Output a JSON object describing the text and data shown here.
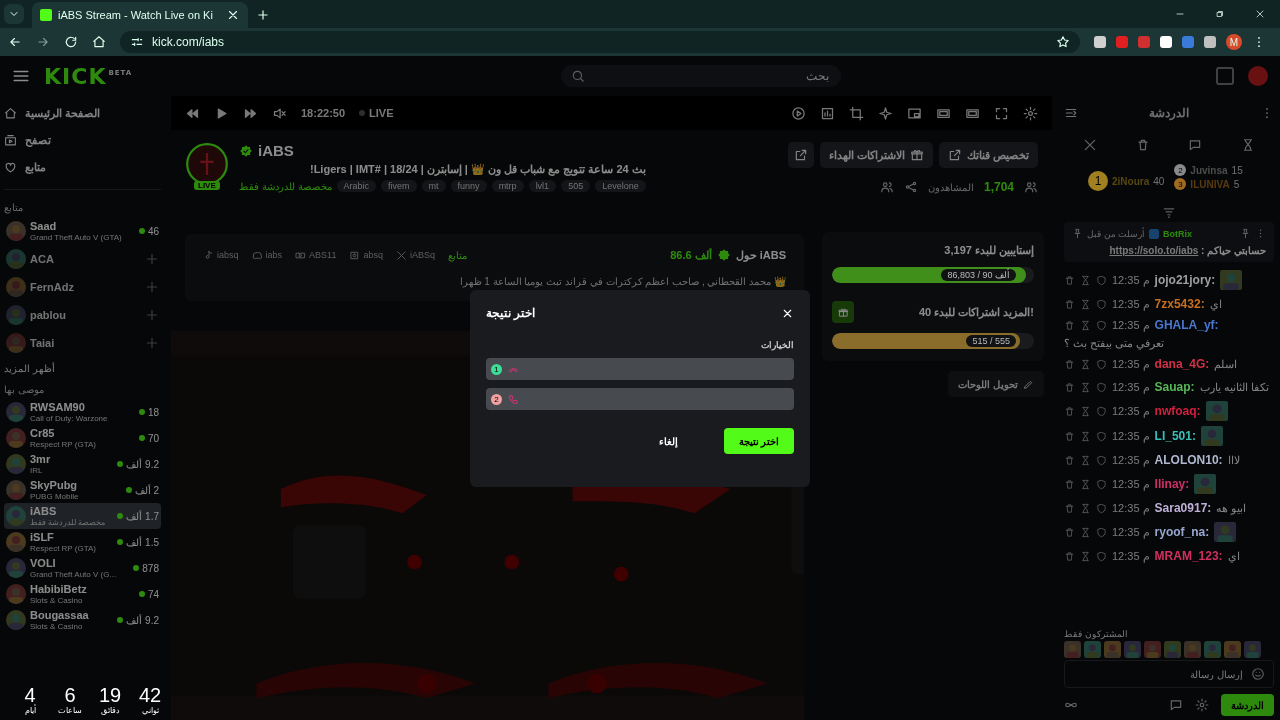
{
  "browser": {
    "tab_title": "iABS Stream - Watch Live on Ki",
    "url": "kick.com/iabs",
    "profile": "M"
  },
  "header": {
    "logo": "KICK",
    "logo_badge": "BETA",
    "search_placeholder": "بحث"
  },
  "sidebar": {
    "nav": [
      {
        "label": "الصفحة الرئيسية",
        "kind": "home"
      },
      {
        "label": "تصفح",
        "kind": "browse"
      },
      {
        "label": "متابع",
        "kind": "heart"
      }
    ],
    "followed_title": "متابع",
    "followed": [
      {
        "name": "Saad",
        "category": "Grand Theft Auto V (GTA)",
        "viewers": "46",
        "live": true
      },
      {
        "name": "ACA",
        "live": false
      },
      {
        "name": "FernAdz",
        "live": false
      },
      {
        "name": "pablou",
        "live": false
      },
      {
        "name": "Taiai",
        "live": false
      }
    ],
    "show_more": "أظهر المزيد",
    "recommended_title": "موصى بها",
    "recommended": [
      {
        "name": "RWSAM90",
        "category": "Call of Duty: Warzone",
        "viewers": "18",
        "selected": false
      },
      {
        "name": "Cr85",
        "category": "Respect RP (GTA)",
        "viewers": "70",
        "selected": false
      },
      {
        "name": "3mr",
        "category": "IRL",
        "viewers": "9.2 ألف",
        "selected": false
      },
      {
        "name": "SkyPubg",
        "category": "PUBG Mobile",
        "viewers": "2 ألف",
        "selected": false
      },
      {
        "name": "iABS",
        "category": "مخصصة للدردشة فقط",
        "viewers": "1.7 ألف",
        "selected": true
      },
      {
        "name": "iSLF",
        "category": "Respect RP (GTA)",
        "viewers": "1.5 ألف",
        "selected": false
      },
      {
        "name": "VOLI",
        "category": "Grand Theft Auto V (G...",
        "viewers": "878",
        "selected": false
      },
      {
        "name": "HabibiBetz",
        "category": "Slots & Casino",
        "viewers": "74",
        "selected": false
      },
      {
        "name": "Bougassaa",
        "category": "Slots & Casino",
        "viewers": "9.2 ألف",
        "selected": false
      }
    ]
  },
  "player": {
    "time": "18:22:50",
    "live": "LIVE"
  },
  "stream": {
    "name": "iABS",
    "live_badge": "LIVE",
    "title": "بث 24 ساعة تتويج مع شباب قل ون 👑 | إسابترن | 18/24 | #Ligers | IMT!",
    "category": "مخصصة للدردشة فقط",
    "tags": [
      "Levelone",
      "505",
      "lvl1",
      "mtrp",
      "funny",
      "mt",
      "fivem",
      "Arabic"
    ],
    "actions": [
      "تخصيص قناتك",
      "الاشتراكات الهداء"
    ],
    "viewers": "1,704",
    "viewers_label": "المشاهدون"
  },
  "about": {
    "title": "حول iABS",
    "followers": "86.6 ألف",
    "followers_label": "متابع",
    "socials": [
      {
        "label": "iABSq",
        "kind": "x"
      },
      {
        "label": "absq",
        "kind": "instagram"
      },
      {
        "label": "ABS11",
        "kind": "youtube"
      },
      {
        "label": "iabs",
        "kind": "discord"
      },
      {
        "label": "iabsq",
        "kind": "tiktok"
      }
    ],
    "bio": "👑 محمد القحطاني , صاحب اعظم كركترات في قراند تبث يوميا الساعة 1 ظهرا"
  },
  "goals": [
    {
      "label": "إستايبين للبدء",
      "count": "3,197",
      "progress": "86,803 / 90 ألف",
      "level": 0.96,
      "color": "#3f8f1a",
      "kind": "follows"
    },
    {
      "label": "!المزيد اشتراكات للبدء",
      "count": "40",
      "progress": "515 / 555",
      "level": 0.93,
      "color": "#8a6d2a",
      "kind": "subs"
    }
  ],
  "panels_button": "تحويل اللوحات",
  "modal": {
    "title": "اختر نتيجة",
    "section": "الخيارات",
    "options": [
      {
        "number": "1",
        "color": "#3ddc97",
        "kind": "phone-off"
      },
      {
        "number": "2",
        "color": "#f2a0a0",
        "kind": "phone"
      }
    ],
    "cancel": "إلغاء",
    "confirm": "اختر نتيجة"
  },
  "chat": {
    "title": "الدردشة",
    "leaderboard": [
      {
        "rank": "1",
        "name": "2iNoura",
        "count": "40",
        "color": "#a08020"
      },
      {
        "rank": "2",
        "name": "Juvinsa",
        "count": "15",
        "color": "#8a8a8a"
      },
      {
        "rank": "3",
        "name": "ILUNIVA",
        "count": "5",
        "color": "#a06a20"
      }
    ],
    "pinned": {
      "sent_by": "أرسلت من قبل",
      "author": "BotRix",
      "text": "حسابتي حياكم :",
      "link": "https://solo.to/iabs"
    },
    "messages": [
      {
        "time": "12:35 م",
        "user": "jojo21jory:",
        "color": "#a0a0a0"
      },
      {
        "time": "12:35 م",
        "user": "7zx5432:",
        "color": "#c8701e",
        "kind": "text",
        "text": "اي"
      },
      {
        "time": "12:35 م",
        "user": "GHALA_yf:",
        "color": "#4a78d0",
        "kind": "text",
        "text": "تعرفي متى بيفتح بث ؟"
      },
      {
        "time": "12:35 م",
        "user": "dana_4G:",
        "color": "#d03048",
        "kind": "text",
        "text": "اسلم"
      },
      {
        "time": "12:35 م",
        "user": "Sauap:",
        "color": "#58b858",
        "kind": "text",
        "text": "تكفا الثانيه يارب"
      },
      {
        "time": "12:35 م",
        "user": "nwfoaq:",
        "color": "#d02040"
      },
      {
        "time": "12:35 م",
        "user": "LI_501:",
        "color": "#38c0b8"
      },
      {
        "time": "12:35 م",
        "user": "ALOLON10:",
        "color": "#b0b8d0",
        "kind": "text",
        "text": "لااا"
      },
      {
        "time": "12:35 م",
        "user": "llinay:",
        "color": "#d03068"
      },
      {
        "time": "12:35 م",
        "user": "Sara0917:",
        "color": "#c0b0d8",
        "kind": "text",
        "text": "ابيو هه"
      },
      {
        "time": "12:35 م",
        "user": "ryoof_na:",
        "color": "#98a8d0"
      },
      {
        "time": "12:35 م",
        "user": "MRAM_123:",
        "color": "#d03060",
        "kind": "text",
        "text": "اي"
      }
    ],
    "subscribers_label": "المشتركون فقط",
    "input_placeholder": "إرسال رسالة",
    "send_label": "الدردشة"
  },
  "countdown": [
    {
      "value": "42",
      "unit": "ثواني"
    },
    {
      "value": "19",
      "unit": "دقائق"
    },
    {
      "value": "6",
      "unit": "ساعات"
    },
    {
      "value": "4",
      "unit": "أيام"
    }
  ]
}
